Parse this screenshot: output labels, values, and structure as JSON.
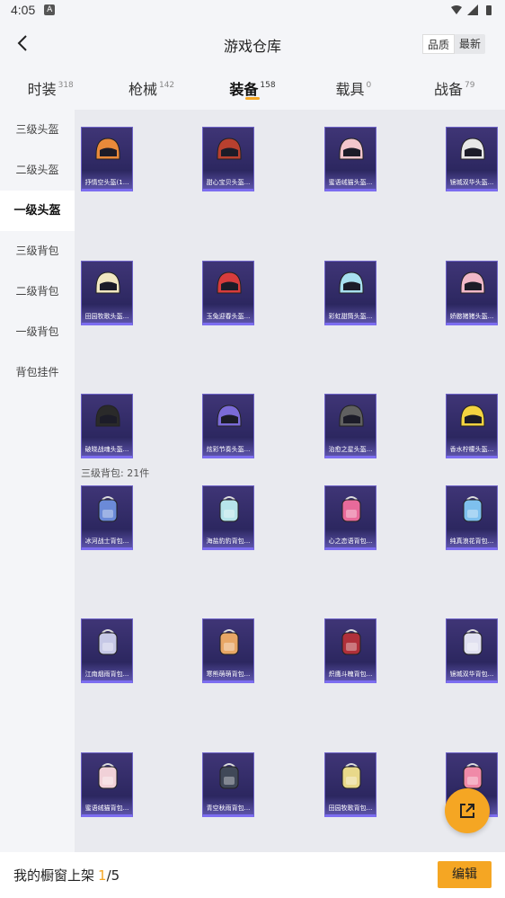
{
  "status": {
    "time": "4:05"
  },
  "header": {
    "title": "游戏仓库",
    "sort_quality": "品质",
    "sort_new": "最新"
  },
  "tabs": [
    {
      "label": "时装",
      "count": "318"
    },
    {
      "label": "枪械",
      "count": "142"
    },
    {
      "label": "装备",
      "count": "158"
    },
    {
      "label": "载具",
      "count": "0"
    },
    {
      "label": "战备",
      "count": "79"
    }
  ],
  "sidebar": [
    "三级头盔",
    "二级头盔",
    "一级头盔",
    "三级背包",
    "二级背包",
    "一级背包",
    "背包挂件"
  ],
  "section_label": "三级背包: 21件",
  "helmets": [
    {
      "name": "抒情空头盔(1...",
      "icon": "helmet-icon"
    },
    {
      "name": "甜心宝贝头盔...",
      "icon": "helmet-icon"
    },
    {
      "name": "蜜语绒猫头盔...",
      "icon": "helmet-icon"
    },
    {
      "name": "镜城双华头盔...",
      "icon": "helmet-icon"
    },
    {
      "name": "田园牧歌头盔...",
      "icon": "helmet-icon"
    },
    {
      "name": "玉兔迎春头盔...",
      "icon": "helmet-icon"
    },
    {
      "name": "彩虹甜筒头盔...",
      "icon": "helmet-icon"
    },
    {
      "name": "娇憨猪猪头盔...",
      "icon": "helmet-icon"
    },
    {
      "name": "破晓战魂头盔...",
      "icon": "helmet-icon"
    },
    {
      "name": "炫彩节奏头盔...",
      "icon": "helmet-icon"
    },
    {
      "name": "治愈之星头盔...",
      "icon": "helmet-icon"
    },
    {
      "name": "香水柠檬头盔...",
      "icon": "helmet-icon"
    }
  ],
  "backpacks": [
    {
      "name": "冰河战士背包...",
      "icon": "backpack-icon"
    },
    {
      "name": "海盐豹豹背包...",
      "icon": "backpack-icon"
    },
    {
      "name": "心之恋语背包...",
      "icon": "backpack-icon"
    },
    {
      "name": "纯真浪花背包...",
      "icon": "backpack-icon"
    },
    {
      "name": "江南烟雨背包...",
      "icon": "backpack-icon"
    },
    {
      "name": "寒熊萌萌背包...",
      "icon": "backpack-icon"
    },
    {
      "name": "炽鹰斗魄背包...",
      "icon": "backpack-icon"
    },
    {
      "name": "镜城双华背包...",
      "icon": "backpack-icon"
    },
    {
      "name": "蜜语绒猫背包...",
      "icon": "backpack-icon"
    },
    {
      "name": "青空秋雨背包...",
      "icon": "backpack-icon"
    },
    {
      "name": "田园牧歌背包...",
      "icon": "backpack-icon"
    },
    {
      "name": "",
      "icon": "backpack-icon"
    }
  ],
  "colors": {
    "accent": "#f5a623",
    "card_border": "#7c6df0"
  },
  "footer": {
    "label": "我的橱窗上架",
    "count": "1",
    "total": "/5",
    "edit": "编辑"
  }
}
